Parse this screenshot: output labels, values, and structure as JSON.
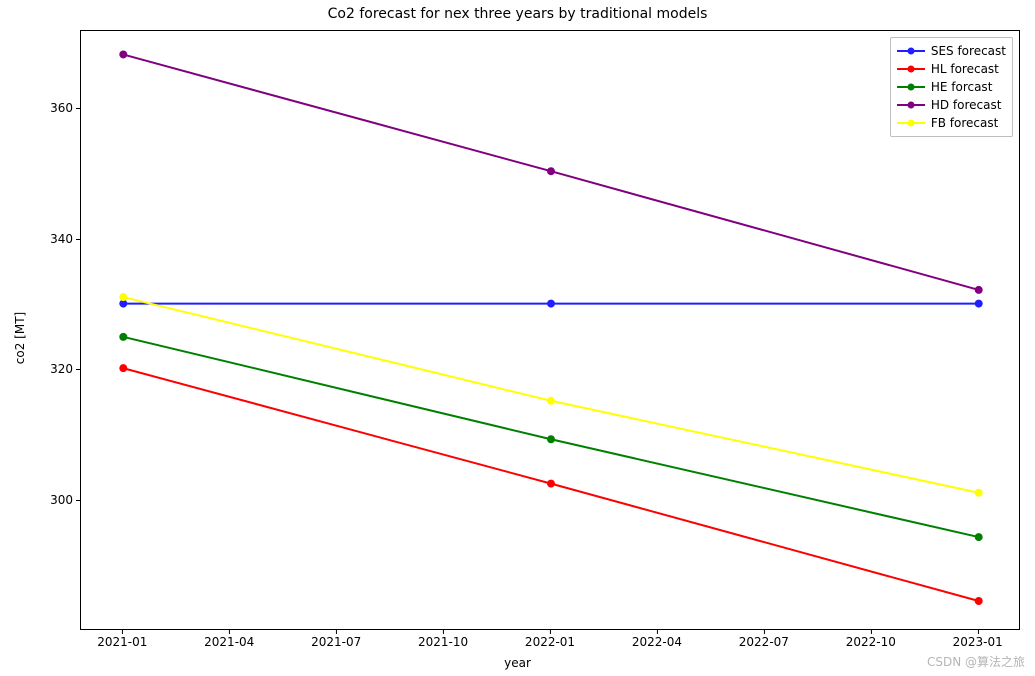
{
  "chart_data": {
    "type": "line",
    "title": "Co2 forecast for nex three years by traditional models",
    "xlabel": "year",
    "ylabel": "co2 [MT]",
    "x": [
      "2021-01",
      "2022-01",
      "2023-01"
    ],
    "x_ticks": [
      "2021-01",
      "2021-04",
      "2021-07",
      "2021-10",
      "2022-01",
      "2022-04",
      "2022-07",
      "2022-10",
      "2023-01"
    ],
    "y_ticks": [
      300,
      320,
      340,
      360
    ],
    "ylim": [
      280,
      372
    ],
    "series": [
      {
        "name": "SES forecast",
        "color": "#1f1fff",
        "values": [
          330.2,
          330.2,
          330.2
        ]
      },
      {
        "name": "HL forecast",
        "color": "#ff0000",
        "values": [
          320.3,
          302.6,
          284.6
        ]
      },
      {
        "name": "HE forcast",
        "color": "#008000",
        "values": [
          325.1,
          309.4,
          294.4
        ]
      },
      {
        "name": "HD forecast",
        "color": "#800080",
        "values": [
          368.4,
          350.5,
          332.3
        ]
      },
      {
        "name": "FB forecast",
        "color": "#ffff00",
        "values": [
          331.2,
          315.3,
          301.2
        ]
      }
    ],
    "legend_position": "upper right",
    "grid": false
  },
  "watermark": "CSDN @算法之旅"
}
